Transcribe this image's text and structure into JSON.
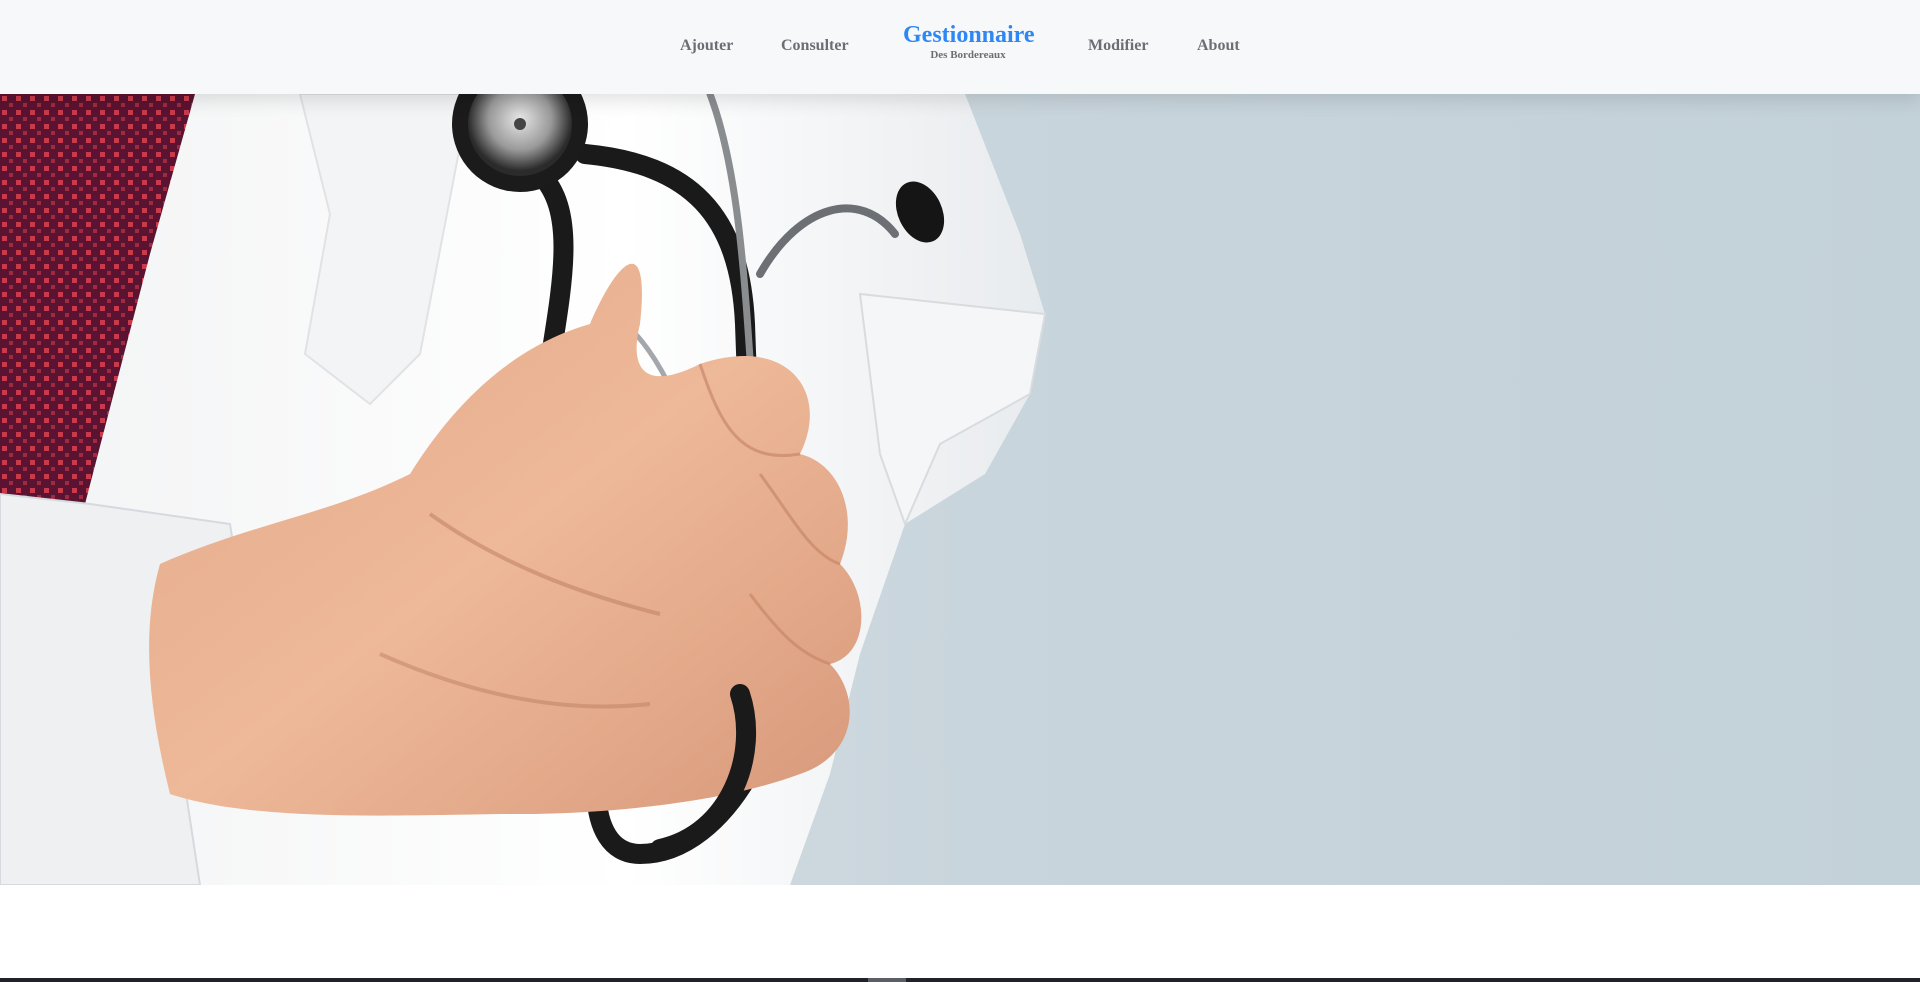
{
  "nav": {
    "links": [
      {
        "label": "Ajouter"
      },
      {
        "label": "Consulter"
      },
      {
        "label": "Modifier"
      },
      {
        "label": "About"
      }
    ],
    "brand": {
      "title": "Gestionnaire",
      "subtitle": "Des Bordereaux"
    }
  },
  "colors": {
    "brand": "#2f87f4",
    "nav_text": "#6b6f74",
    "nav_bg": "#f7f8fa",
    "hero_bg": "#c3d1d9"
  }
}
